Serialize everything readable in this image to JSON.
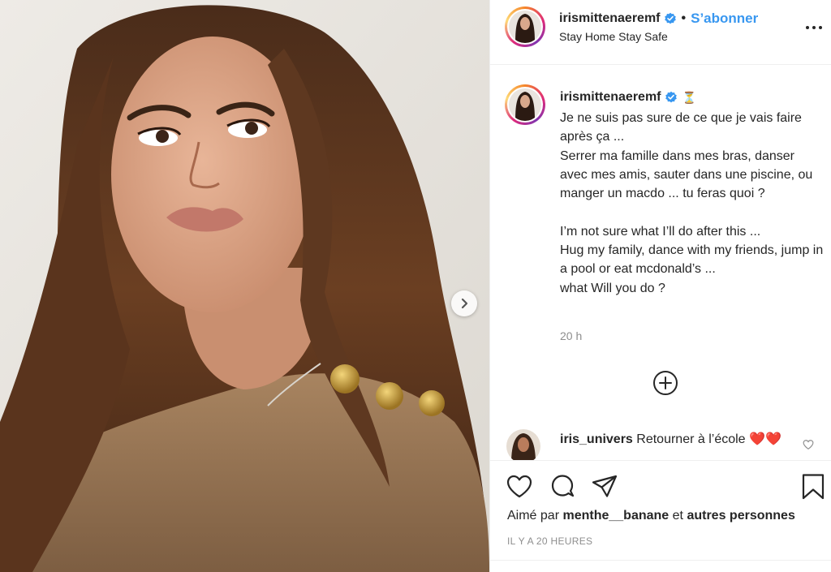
{
  "post": {
    "username": "irismittenaeremf",
    "follow_label": "S’abonner",
    "location": "Stay Home Stay Safe",
    "more_icon": "ellipsis-icon"
  },
  "caption": {
    "username": "irismittenaeremf",
    "emoji": "⏳",
    "text": "Je ne suis pas sure de ce que je vais faire après ça ...\nSerrer ma famille dans mes bras, danser avec mes amis, sauter dans une piscine, ou manger un macdo ... tu feras quoi ?\n\nI’m not sure what I’ll do after this ...\nHug my family, dance with my friends, jump in a pool or eat mcdonald’s ...\nwhat Will you do ?",
    "time": "20 h"
  },
  "comments": [
    {
      "username": "iris_univers",
      "text": "Retourner à l’école ❤️❤️"
    }
  ],
  "likes": {
    "prefix": "Aimé par",
    "user": "menthe__banane",
    "conjunction": "et",
    "others": "autres personnes"
  },
  "timestamp": "IL Y A 20 HEURES",
  "colors": {
    "accent": "#3897f0",
    "verified": "#3897f0",
    "text": "#262626",
    "muted": "#8e8e8e",
    "border": "#efefef"
  }
}
